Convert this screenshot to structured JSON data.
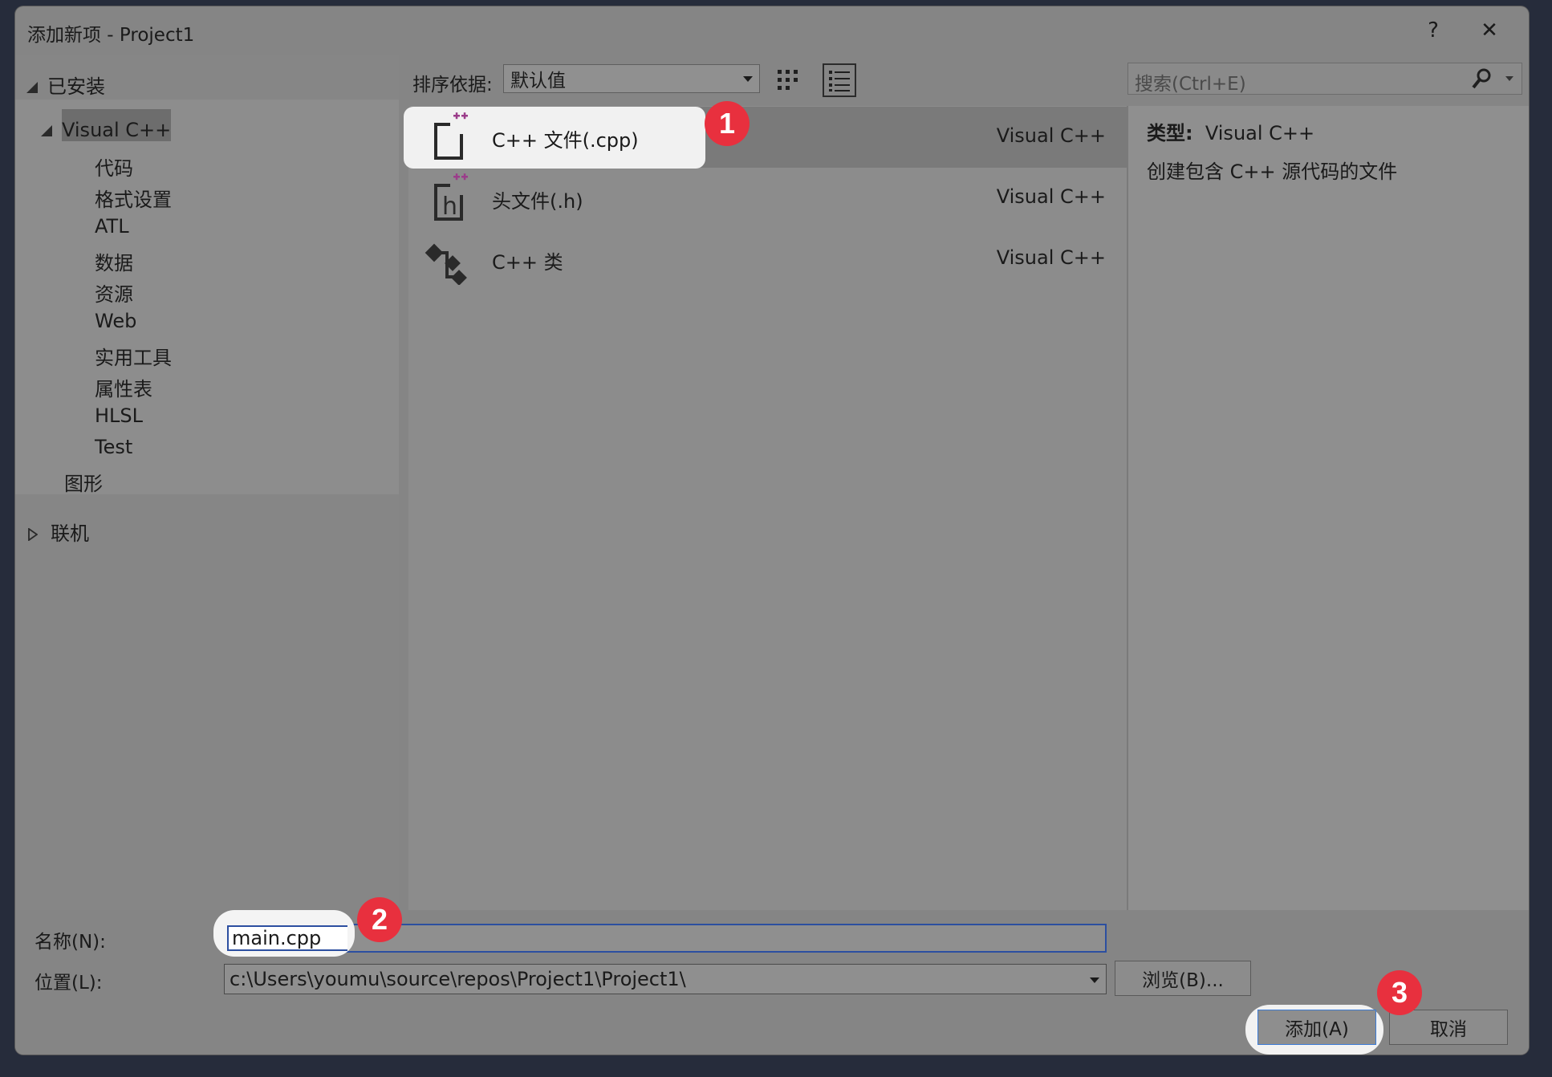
{
  "window": {
    "title": "添加新项 - Project1",
    "help_label": "?",
    "close_label": "✕"
  },
  "tree": {
    "installed": "已安装",
    "visual_cpp": "Visual C++",
    "children": [
      "代码",
      "格式设置",
      "ATL",
      "数据",
      "资源",
      "Web",
      "实用工具",
      "属性表",
      "HLSL",
      "Test"
    ],
    "graphics": "图形",
    "online": "联机"
  },
  "toolbar": {
    "sort_label": "排序依据:",
    "sort_value": "默认值",
    "search_placeholder": "搜索(Ctrl+E)"
  },
  "items": [
    {
      "name": "C++ 文件(.cpp)",
      "lang": "Visual C++"
    },
    {
      "name": "头文件(.h)",
      "lang": "Visual C++"
    },
    {
      "name": "C++ 类",
      "lang": "Visual C++"
    }
  ],
  "details": {
    "type_label": "类型:",
    "type_value": "Visual C++",
    "description": "创建包含 C++ 源代码的文件"
  },
  "form": {
    "name_label": "名称(N):",
    "name_value": "main.cpp",
    "location_label": "位置(L):",
    "location_value": "c:\\Users\\youmu\\source\\repos\\Project1\\Project1\\",
    "browse_label": "浏览(B)...",
    "add_label": "添加(A)",
    "cancel_label": "取消"
  },
  "badges": [
    "1",
    "2",
    "3"
  ],
  "colors": {
    "badge": "#e8303e",
    "input_focus": "#2c4fa0",
    "icon_plus": "#9b3d8a"
  }
}
